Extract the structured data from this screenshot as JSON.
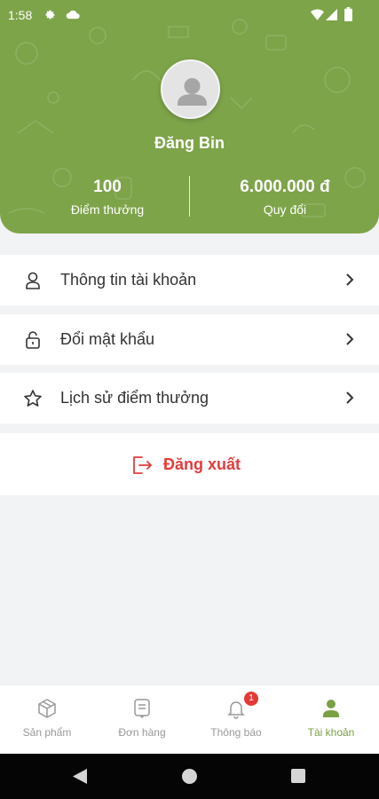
{
  "status_bar": {
    "time": "1:58"
  },
  "profile": {
    "name": "Đăng Bin",
    "points_value": "100",
    "points_label": "Điểm thưởng",
    "convert_value": "6.000.000 đ",
    "convert_label": "Quy đổi"
  },
  "menu": {
    "items": [
      {
        "label": "Thông tin tài khoản",
        "icon": "user-icon"
      },
      {
        "label": "Đổi mật khẩu",
        "icon": "lock-icon"
      },
      {
        "label": "Lịch sử điểm thưởng",
        "icon": "star-icon"
      }
    ],
    "logout_label": "Đăng xuất"
  },
  "bottom_nav": {
    "tabs": [
      {
        "label": "Sản phẩm",
        "icon": "box-icon"
      },
      {
        "label": "Đơn hàng",
        "icon": "receipt-icon"
      },
      {
        "label": "Thông báo",
        "icon": "bell-icon",
        "badge": "1"
      },
      {
        "label": "Tài khoản",
        "icon": "person-icon",
        "active": true
      }
    ]
  },
  "colors": {
    "brand_green": "#7ea44a",
    "logout_red": "#e23c3c",
    "badge_red": "#e53935"
  }
}
